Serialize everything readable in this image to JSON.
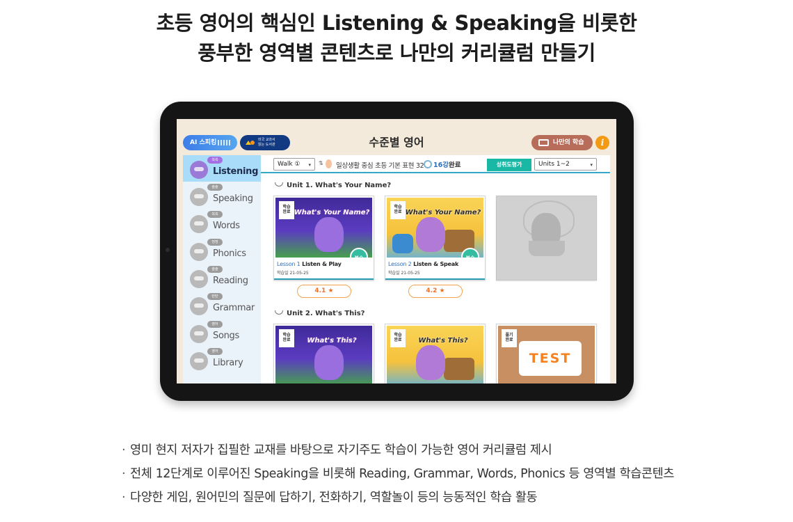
{
  "headline": {
    "line1": "초등 영어의 핵심인 Listening & Speaking을 비롯한",
    "line2": "풍부한 영역별 콘텐츠로 나만의 커리큘럼 만들기"
  },
  "screen": {
    "title": "수준별 영어",
    "ai_pill": "AI 스피킹",
    "textbook_pill_line1": "미국 교과서",
    "textbook_pill_line2": "읽는 도서관",
    "my_learning": "나만의 학습",
    "info_symbol": "i"
  },
  "sidebar": {
    "items": [
      {
        "tag": "쏙쏙",
        "label": "Listening",
        "active": true
      },
      {
        "tag": "술술",
        "label": "Speaking"
      },
      {
        "tag": "쏙쏙",
        "label": "Words"
      },
      {
        "tag": "띵띵",
        "label": "Phonics"
      },
      {
        "tag": "술술",
        "label": "Reading"
      },
      {
        "tag": "탄탄",
        "label": "Grammar"
      },
      {
        "tag": "영어",
        "label": "Songs"
      },
      {
        "tag": "영어",
        "label": "Library"
      }
    ]
  },
  "controls": {
    "level_select": "Walk ①",
    "arrows": "⇅",
    "course_name": "일상생활 중심 초등 기본 표현 32",
    "done_prefix": "16강",
    "done_suffix": "완료",
    "eval_button": "성취도평가",
    "units_select": "Units 1~2",
    "caret": "▾"
  },
  "units": [
    {
      "title": "Unit 1. What's Your Name?",
      "cards": [
        {
          "flag1": "학습",
          "flag2": "완료",
          "image_title": "What's Your Name?",
          "review": "복습",
          "lesson_num": "Lesson 1",
          "lesson_name": "Listen & Play",
          "date": "학습일 21-05-25",
          "score": "4.1 ★"
        },
        {
          "flag1": "학습",
          "flag2": "완료",
          "image_title": "What's Your Name?",
          "review": "복습",
          "lesson_num": "Lesson 2",
          "lesson_name": "Listen & Speak",
          "date": "학습일 21-05-25",
          "score": "4.2 ★"
        },
        {
          "locked": true
        }
      ]
    },
    {
      "title": "Unit 2. What's This?",
      "cards": [
        {
          "flag1": "학습",
          "flag2": "완료",
          "image_title": "What's This?"
        },
        {
          "flag1": "학습",
          "flag2": "완료",
          "image_title": "What's This?"
        },
        {
          "flag1": "풀기",
          "flag2": "완료",
          "image_title": "TEST"
        }
      ]
    }
  ],
  "bullets": {
    "marker": "·",
    "items": [
      "영미 현지 저자가 집필한 교재를 바탕으로 자기주도 학습이 가능한 영어 커리큘럼 제시",
      "전체 12단계로 이루어진 Speaking을 비롯해 Reading, Grammar, Words, Phonics 등 영역별 학습콘텐츠",
      "다양한 게임, 원어민의 질문에 답하기, 전화하기, 역할놀이 등의 능동적인 학습 활동"
    ]
  },
  "colors": {
    "screen_bg": "#f4eadb",
    "accent_teal": "#18b8a5",
    "active_blue": "#a9dcf9",
    "score_orange": "#e8722a"
  }
}
